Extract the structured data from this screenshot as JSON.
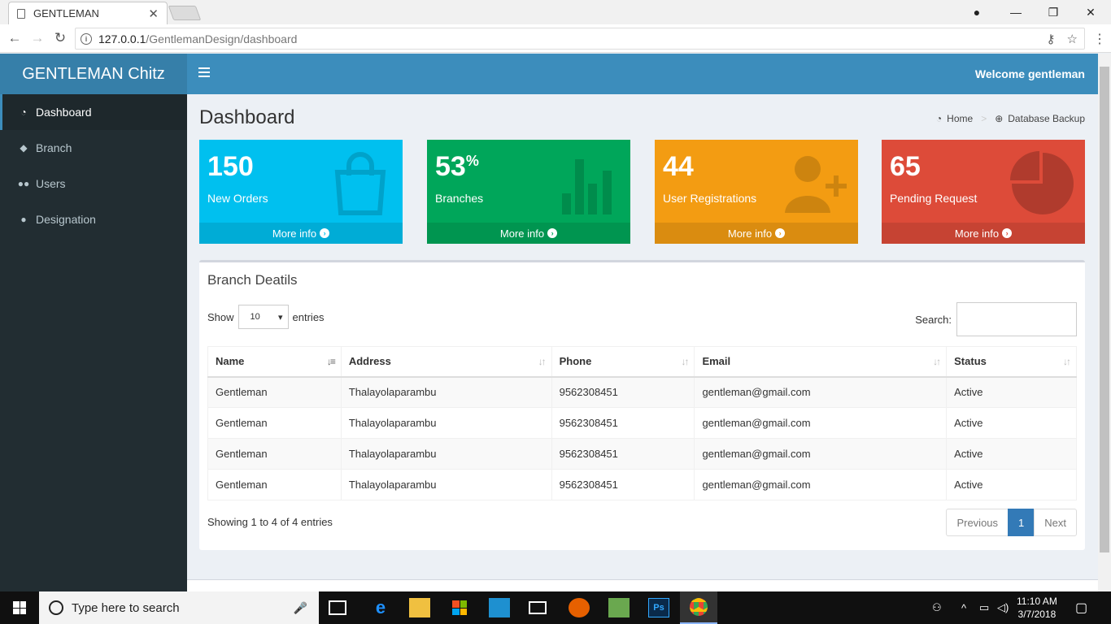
{
  "browser": {
    "tab_title": "GENTLEMAN",
    "url_host": "127.0.0.1",
    "url_path": "/GentlemanDesign/dashboard"
  },
  "app": {
    "brand": "GENTLEMAN Chitz",
    "welcome": "Welcome gentleman",
    "accent": "#3c8dbc"
  },
  "sidebar": {
    "items": [
      {
        "label": "Dashboard",
        "icon": "dashboard-icon"
      },
      {
        "label": "Branch",
        "icon": "cubes-icon"
      },
      {
        "label": "Users",
        "icon": "users-icon"
      },
      {
        "label": "Designation",
        "icon": "user-icon"
      }
    ]
  },
  "page": {
    "title": "Dashboard",
    "breadcrumb": [
      "Home",
      "Database Backup"
    ]
  },
  "stats": [
    {
      "value": "150",
      "suffix": "",
      "label": "New Orders",
      "more": "More info",
      "color": "#00c0ef",
      "icon": "shopping-bag-icon"
    },
    {
      "value": "53",
      "suffix": "%",
      "label": "Branches",
      "more": "More info",
      "color": "#00a65a",
      "icon": "bar-chart-icon"
    },
    {
      "value": "44",
      "suffix": "",
      "label": "User Registrations",
      "more": "More info",
      "color": "#f39c12",
      "icon": "user-plus-icon"
    },
    {
      "value": "65",
      "suffix": "",
      "label": "Pending Request",
      "more": "More info",
      "color": "#dd4b39",
      "icon": "pie-chart-icon"
    }
  ],
  "branch_panel": {
    "title": "Branch Deatils",
    "show_label": "Show",
    "entries_label": "entries",
    "page_length": "10",
    "search_label": "Search:",
    "columns": [
      "Name",
      "Address",
      "Phone",
      "Email",
      "Status"
    ],
    "rows": [
      [
        "Gentleman",
        "Thalayolaparambu",
        "9562308451",
        "gentleman@gmail.com",
        "Active"
      ],
      [
        "Gentleman",
        "Thalayolaparambu",
        "9562308451",
        "gentleman@gmail.com",
        "Active"
      ],
      [
        "Gentleman",
        "Thalayolaparambu",
        "9562308451",
        "gentleman@gmail.com",
        "Active"
      ],
      [
        "Gentleman",
        "Thalayolaparambu",
        "9562308451",
        "gentleman@gmail.com",
        "Active"
      ]
    ],
    "info": "Showing 1 to 4 of 4 entries",
    "pager": {
      "previous": "Previous",
      "current": "1",
      "next": "Next"
    }
  },
  "taskbar": {
    "search_placeholder": "Type here to search",
    "time": "11:10 AM",
    "date": "3/7/2018"
  }
}
